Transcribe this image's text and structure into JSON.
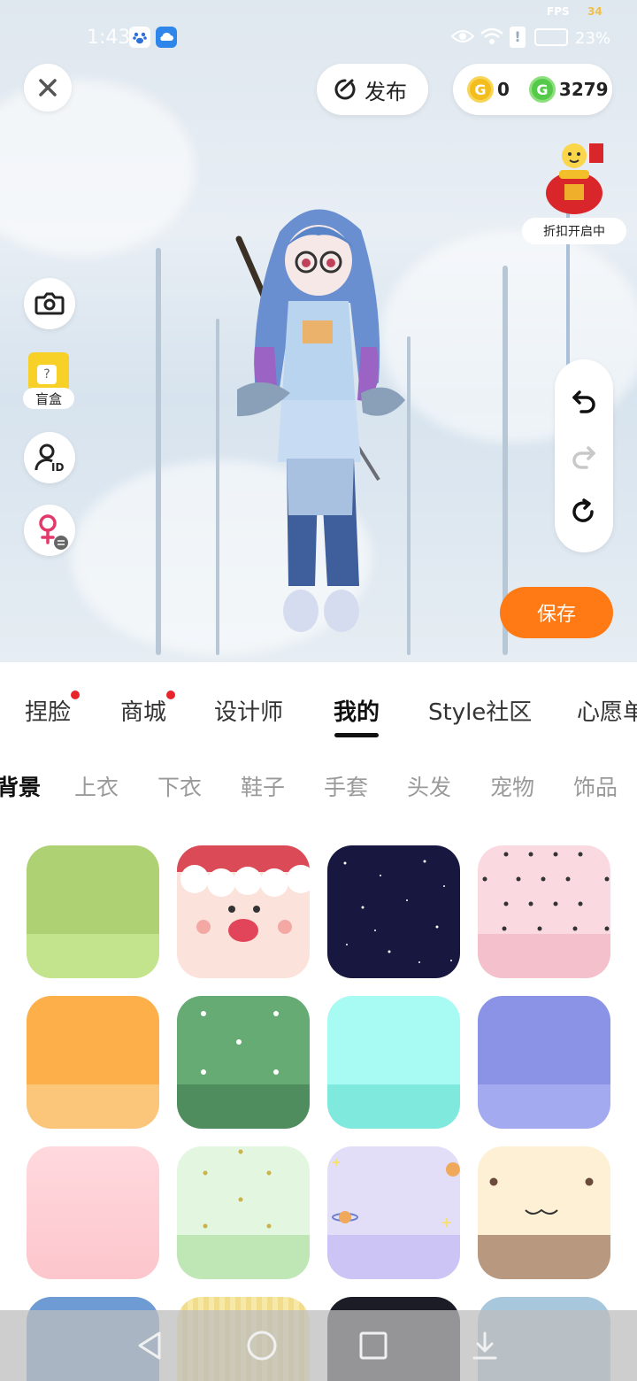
{
  "status": {
    "time": "1:43",
    "fps_label": "FPS",
    "fps_value": "34",
    "battery": "23%"
  },
  "header": {
    "publish_label": "发布",
    "gold_coins": "0",
    "green_coins": "3279"
  },
  "promo": {
    "label": "折扣开启中"
  },
  "side": {
    "mystery_box_label": "盲盒"
  },
  "save_label": "保存",
  "tabs": [
    {
      "label": "捏脸",
      "dot": true
    },
    {
      "label": "商城",
      "dot": true
    },
    {
      "label": "设计师",
      "dot": false
    },
    {
      "label": "我的",
      "dot": false,
      "active": true
    },
    {
      "label": "Style社区",
      "dot": false
    },
    {
      "label": "心愿单",
      "dot": false
    }
  ],
  "subtabs": [
    {
      "label": "背景",
      "active": true
    },
    {
      "label": "上衣"
    },
    {
      "label": "下衣"
    },
    {
      "label": "鞋子"
    },
    {
      "label": "手套"
    },
    {
      "label": "头发"
    },
    {
      "label": "宠物"
    },
    {
      "label": "饰品"
    }
  ],
  "colors": {
    "accent": "#ff7a14",
    "notification_dot": "#e8232a"
  },
  "backgrounds": [
    {
      "name": "green-solid",
      "top": "#aed174",
      "bottom": "#c4e38d"
    },
    {
      "name": "santa",
      "top": "#fbe3dc",
      "bottom": "#fbe3dc"
    },
    {
      "name": "starry-night",
      "top": "#17173f",
      "bottom": "#17173f"
    },
    {
      "name": "pink-hearts",
      "top": "#fbd9e1",
      "bottom": "#f3c0cb"
    },
    {
      "name": "orange-solid",
      "top": "#fdb04a",
      "bottom": "#fbc57a"
    },
    {
      "name": "green-snowflake",
      "top": "#66aa74",
      "bottom": "#4f8d5e"
    },
    {
      "name": "aqua-solid",
      "top": "#a8fbf2",
      "bottom": "#7fe9de"
    },
    {
      "name": "periwinkle-solid",
      "top": "#8a93e6",
      "bottom": "#a4aaf0"
    },
    {
      "name": "pink-gradient",
      "top": "#ffd9de",
      "bottom": "#fcc6cc"
    },
    {
      "name": "mint-stars",
      "top": "#e3f6e0",
      "bottom": "#bfe7b5"
    },
    {
      "name": "lavender-planets",
      "top": "#e2def7",
      "bottom": "#cbc4f4"
    },
    {
      "name": "cream-face",
      "top": "#fdf0d5",
      "bottom": "#b89980"
    },
    {
      "name": "blue-palace",
      "top": "#6f9bd4",
      "bottom": "#b48d74"
    },
    {
      "name": "yellow-stripes",
      "top": "#f6e9a8",
      "bottom": "#f3df8c"
    },
    {
      "name": "dark-solid",
      "top": "#1c1c26",
      "bottom": "#1c1c26"
    },
    {
      "name": "window-scene",
      "top": "#a7c7dd",
      "bottom": "#c5a07d"
    }
  ],
  "icons": {
    "close": "close-icon",
    "publish": "publish-icon",
    "camera": "camera-icon",
    "id": "id-icon",
    "gender": "gender-switch-icon",
    "undo": "undo-icon",
    "redo": "redo-icon",
    "reset": "reset-icon"
  }
}
